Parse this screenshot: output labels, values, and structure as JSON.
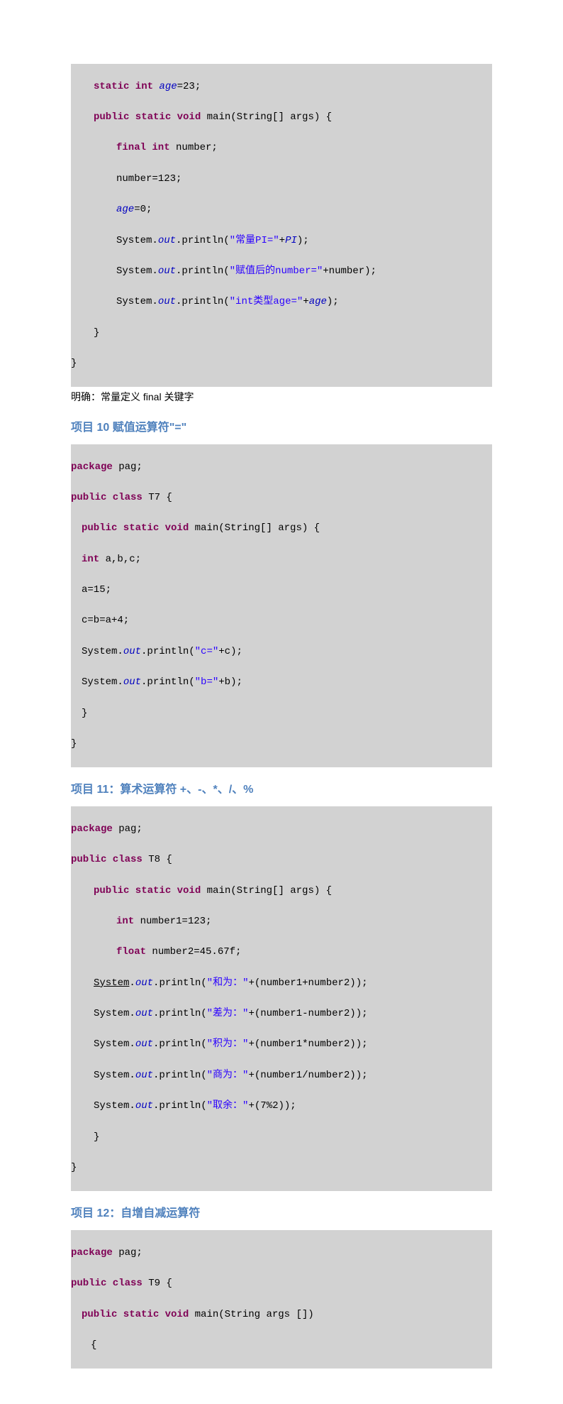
{
  "block1": {
    "l1_kw": "static int",
    "l1_field": " age",
    "l1_rest": "=23;",
    "l2_kw": "public static void",
    "l2_rest": " main(String[] args) {",
    "l3_kw": "final int",
    "l3_rest": " number;",
    "l4": "number=123;",
    "l5_field": "age",
    "l5_rest": "=0;",
    "l6_a": "System.",
    "l6_field": "out",
    "l6_b": ".println(",
    "l6_str": "\"常量PI=\"",
    "l6_c": "+",
    "l6_field2": "PI",
    "l6_d": ");",
    "l7_a": "System.",
    "l7_field": "out",
    "l7_b": ".println(",
    "l7_str": "\"赋值后的number=\"",
    "l7_c": "+number);",
    "l8_a": "System.",
    "l8_field": "out",
    "l8_b": ".println(",
    "l8_str": "\"int类型age=\"",
    "l8_c": "+",
    "l8_field2": "age",
    "l8_d": ");",
    "l9": "}",
    "l10": "}"
  },
  "note1": "明确：常量定义 final 关键字",
  "heading10": "项目 10  赋值运算符\"=\"",
  "block2": {
    "l1_kw": "package",
    "l1_rest": " pag;",
    "l2_kw": "public class",
    "l2_rest": " T7 {",
    "l3_kw": "public static void",
    "l3_rest": " main(String[] args) {",
    "l4_kw": "int",
    "l4_rest": " a,b,c;",
    "l5": "a=15;",
    "l6": "c=b=a+4;",
    "l7_a": "System.",
    "l7_field": "out",
    "l7_b": ".println(",
    "l7_str": "\"c=\"",
    "l7_c": "+c);",
    "l8_a": "System.",
    "l8_field": "out",
    "l8_b": ".println(",
    "l8_str": "\"b=\"",
    "l8_c": "+b);",
    "l9": "}",
    "l10": "}"
  },
  "heading11": "项目 11：算术运算符 +、-、*、/、%",
  "block3": {
    "l1_kw": "package",
    "l1_rest": " pag;",
    "l2_kw": "public class",
    "l2_rest": " T8 {",
    "l3_kw": "public static void",
    "l3_rest": " main(String[] args) {",
    "l4_kw": "int",
    "l4_rest": " number1=123;",
    "l5_kw": "float",
    "l5_rest": " number2=45.67f;",
    "l6_sys": "System",
    "l6_dot": ".",
    "l6_field": "out",
    "l6_b": ".println(",
    "l6_str": "\"和为：\"",
    "l6_c": "+(number1+number2));",
    "l7_a": "System.",
    "l7_field": "out",
    "l7_b": ".println(",
    "l7_str": "\"差为：\"",
    "l7_c": "+(number1-number2));",
    "l8_a": "System.",
    "l8_field": "out",
    "l8_b": ".println(",
    "l8_str": "\"积为：\"",
    "l8_c": "+(number1*number2));",
    "l9_a": "System.",
    "l9_field": "out",
    "l9_b": ".println(",
    "l9_str": "\"商为：\"",
    "l9_c": "+(number1/number2));",
    "l10_a": "System.",
    "l10_field": "out",
    "l10_b": ".println(",
    "l10_str": "\"取余：\"",
    "l10_c": "+(7%2));",
    "l11": "}",
    "l12": "}"
  },
  "heading12": "项目 12：自增自减运算符",
  "block4": {
    "l1_kw": "package",
    "l1_rest": " pag;",
    "l2_kw": "public class",
    "l2_rest": " T9 {",
    "l3_kw": "public static void",
    "l3_rest": " main(String args [])",
    "l4": "{"
  }
}
